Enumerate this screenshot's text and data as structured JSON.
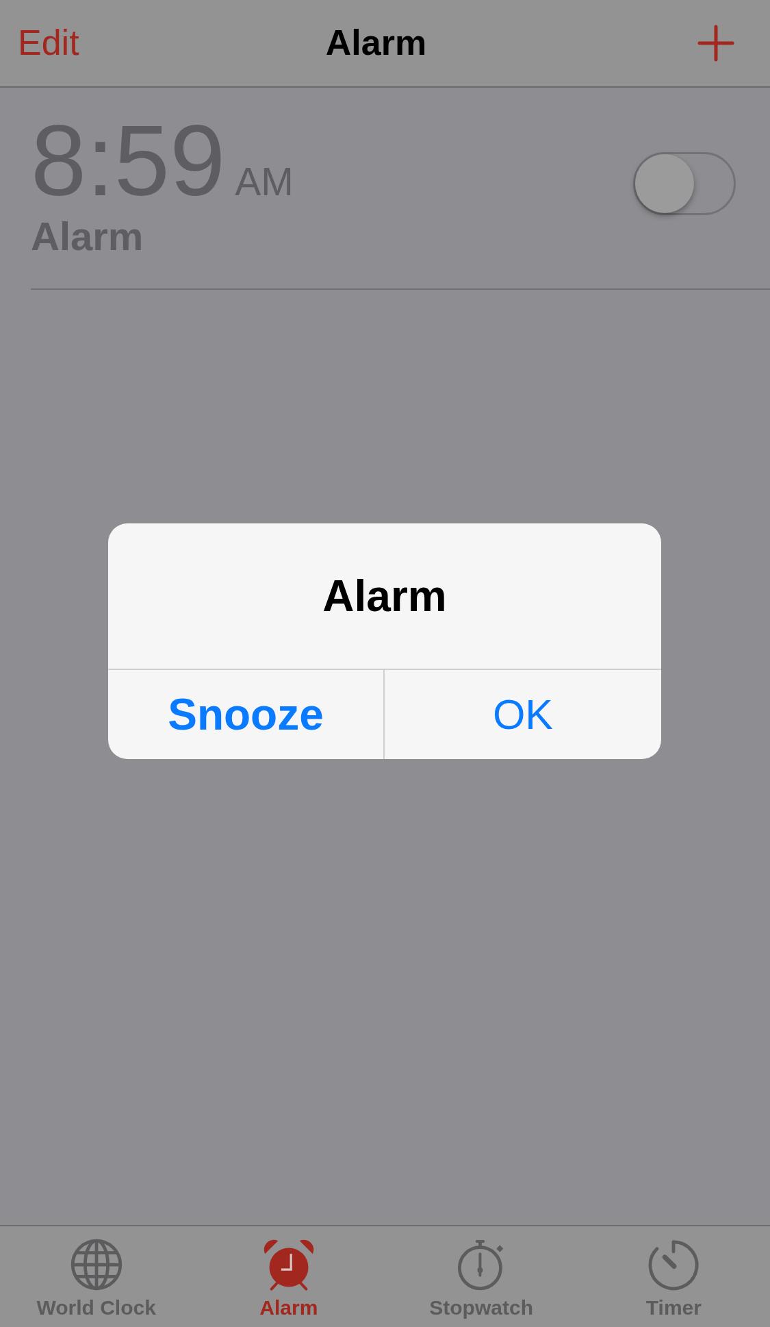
{
  "nav_bar": {
    "left_button": "Edit",
    "title": "Alarm"
  },
  "alarms": [
    {
      "time": "8:59",
      "period": "AM",
      "label": "Alarm",
      "on": false
    }
  ],
  "alert": {
    "title": "Alarm",
    "buttons": [
      {
        "label": "Snooze",
        "kind": "preferred"
      },
      {
        "label": "OK",
        "kind": "default"
      }
    ]
  },
  "tab_bar": [
    {
      "label": "World Clock",
      "selected": false
    },
    {
      "label": "Alarm",
      "selected": true
    },
    {
      "label": "Stopwatch",
      "selected": false
    },
    {
      "label": "Timer",
      "selected": false
    }
  ]
}
